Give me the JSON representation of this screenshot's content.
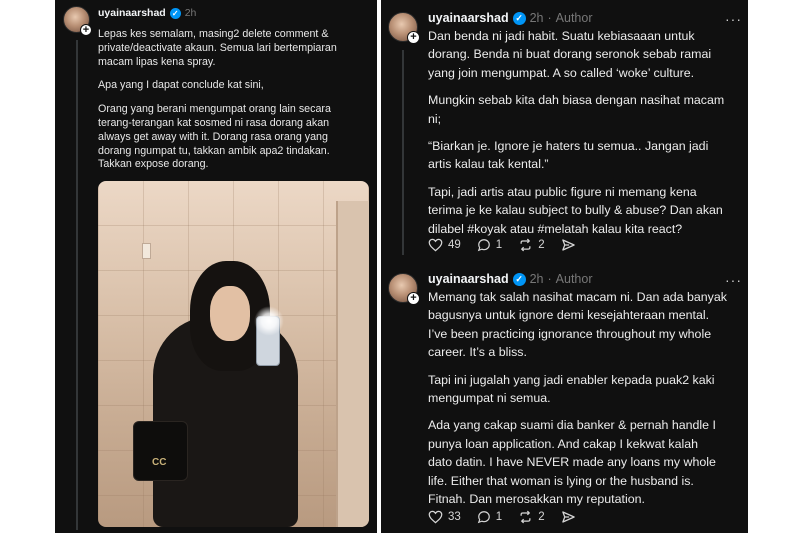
{
  "left_post": {
    "username": "uyainaarshad",
    "time": "2h",
    "paragraphs": [
      [
        "Lepas kes semalam, masing2 delete comment &",
        "private/deactivate akaun. Semua lari bertempiaran",
        "macam lipas kena spray."
      ],
      [
        "Apa yang I dapat conclude kat sini,"
      ],
      [
        "Orang yang berani mengumpat orang lain secara",
        "terang-terangan kat sosmed ni rasa dorang akan",
        "always get away with it. Dorang rasa orang yang",
        "dorang ngumpat tu, takkan ambik apa2 tindakan.",
        "Takkan expose dorang."
      ]
    ],
    "photo": {
      "bag_logo": "CC"
    }
  },
  "right_post_1": {
    "username": "uyainaarshad",
    "time": "2h",
    "role": "Author",
    "paragraphs": [
      [
        "Dan benda ni jadi habit. Suatu kebiasaaan untuk",
        "dorang. Benda ni buat dorang seronok sebab ramai",
        "yang join mengumpat. A so called ‘woke’ culture."
      ],
      [
        "Mungkin sebab kita dah biasa dengan nasihat macam",
        "ni;"
      ],
      [
        "“Biarkan je. Ignore je haters tu semua.. Jangan jadi",
        "artis kalau tak kental.”"
      ],
      [
        "Tapi, jadi artis atau public figure ni memang kena",
        "terima je ke kalau subject to bully & abuse? Dan akan",
        "dilabel #koyak atau #melatah kalau kita react?"
      ]
    ],
    "likes": "49",
    "replies": "1",
    "reposts": "2"
  },
  "right_post_2": {
    "username": "uyainaarshad",
    "time": "2h",
    "role": "Author",
    "paragraphs": [
      [
        "Memang tak salah nasihat macam ni. Dan ada banyak",
        "bagusnya untuk ignore demi kesejahteraan mental.",
        "I’ve been practicing ignorance throughout my whole",
        "career. It’s a bliss."
      ],
      [
        "Tapi ini jugalah yang jadi enabler kepada puak2 kaki",
        "mengumpat ni semua."
      ],
      [
        "Ada yang cakap suami dia banker & pernah handle I",
        "punya loan application. And cakap I kekwat kalah",
        "dato datin. I have NEVER made any loans my whole",
        "life. Either that woman is lying or the husband is.",
        "Fitnah. Dan merosakkan my reputation."
      ]
    ],
    "likes": "33",
    "replies": "1",
    "reposts": "2"
  },
  "colors": {
    "background": "#101010",
    "text": "#f3f5f7",
    "muted": "#777777",
    "verified": "#0095f6"
  }
}
